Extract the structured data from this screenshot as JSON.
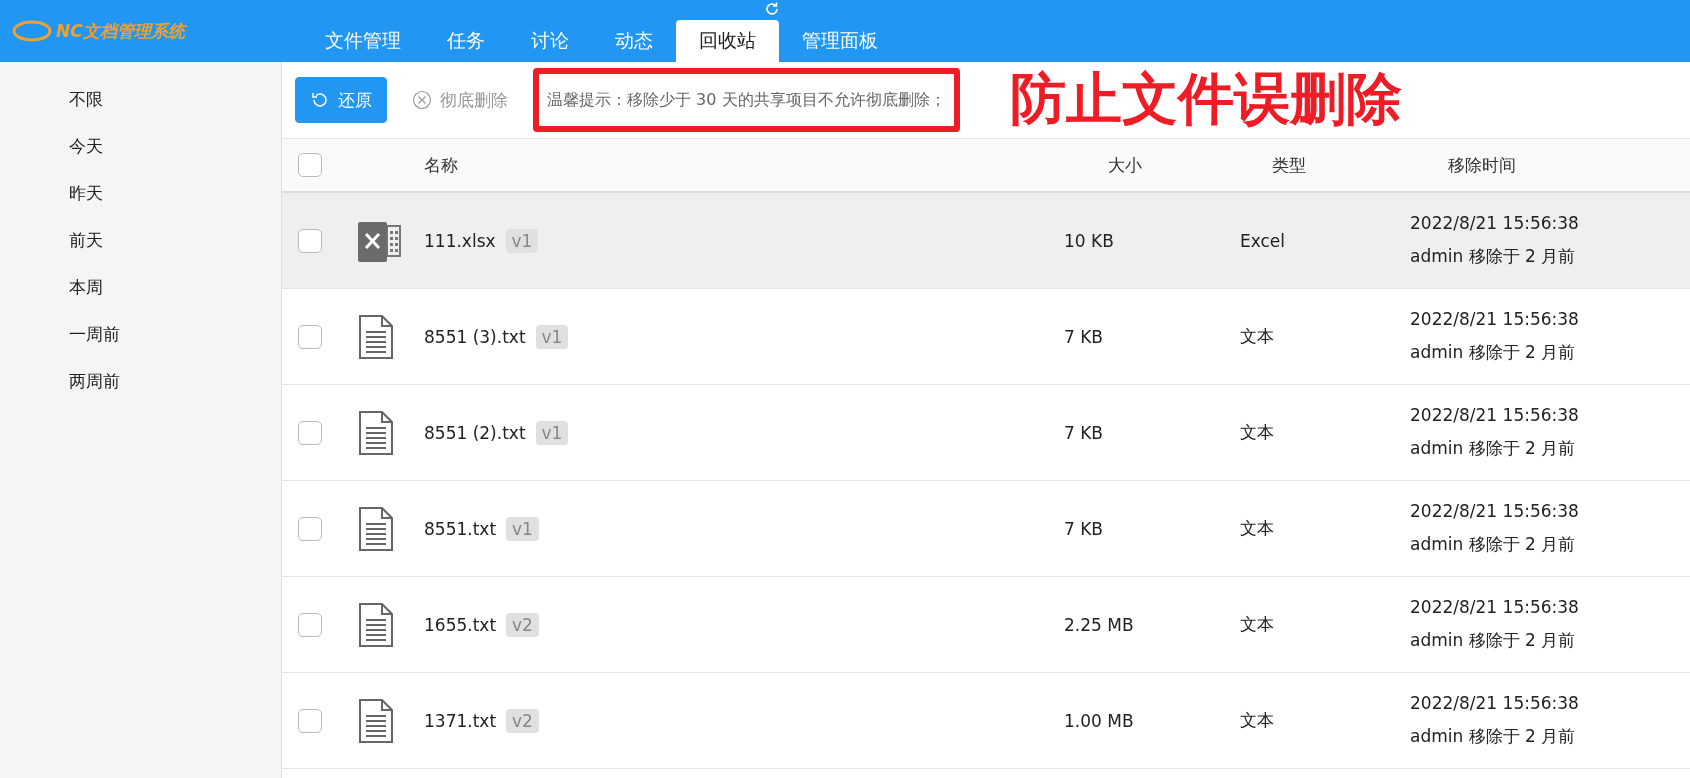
{
  "header": {
    "logo_text": "NC文档管理系统",
    "tabs": [
      {
        "label": "文件管理",
        "selected": false
      },
      {
        "label": "任务",
        "selected": false
      },
      {
        "label": "讨论",
        "selected": false
      },
      {
        "label": "动态",
        "selected": false
      },
      {
        "label": "回收站",
        "selected": true
      },
      {
        "label": "管理面板",
        "selected": false
      }
    ]
  },
  "sidebar": {
    "items": [
      "不限",
      "今天",
      "昨天",
      "前天",
      "本周",
      "一周前",
      "两周前"
    ]
  },
  "toolbar": {
    "restore": "还原",
    "delete": "彻底删除",
    "delete_disabled": true,
    "tip": "温馨提示：移除少于 30 天的共享项目不允许彻底删除；"
  },
  "annotation": "防止文件误删除",
  "table": {
    "select_all_checked": false,
    "columns": [
      "名称",
      "大小",
      "类型",
      "移除时间"
    ],
    "rows": [
      {
        "kind": "excel",
        "name": "111.xlsx",
        "version": "v1",
        "size": "10 KB",
        "type": "Excel",
        "time": "2022/8/21 15:56:38",
        "removed": "admin 移除于 2 月前",
        "highlighted": true,
        "checked": false
      },
      {
        "kind": "text",
        "name": "8551 (3).txt",
        "version": "v1",
        "size": "7 KB",
        "type": "文本",
        "time": "2022/8/21 15:56:38",
        "removed": "admin 移除于 2 月前",
        "highlighted": false,
        "checked": false
      },
      {
        "kind": "text",
        "name": "8551 (2).txt",
        "version": "v1",
        "size": "7 KB",
        "type": "文本",
        "time": "2022/8/21 15:56:38",
        "removed": "admin 移除于 2 月前",
        "highlighted": false,
        "checked": false
      },
      {
        "kind": "text",
        "name": "8551.txt",
        "version": "v1",
        "size": "7 KB",
        "type": "文本",
        "time": "2022/8/21 15:56:38",
        "removed": "admin 移除于 2 月前",
        "highlighted": false,
        "checked": false
      },
      {
        "kind": "text",
        "name": "1655.txt",
        "version": "v2",
        "size": "2.25 MB",
        "type": "文本",
        "time": "2022/8/21 15:56:38",
        "removed": "admin 移除于 2 月前",
        "highlighted": false,
        "checked": false
      },
      {
        "kind": "text",
        "name": "1371.txt",
        "version": "v2",
        "size": "1.00 MB",
        "type": "文本",
        "time": "2022/8/21 15:56:38",
        "removed": "admin 移除于 2 月前",
        "highlighted": false,
        "checked": false
      }
    ]
  }
}
